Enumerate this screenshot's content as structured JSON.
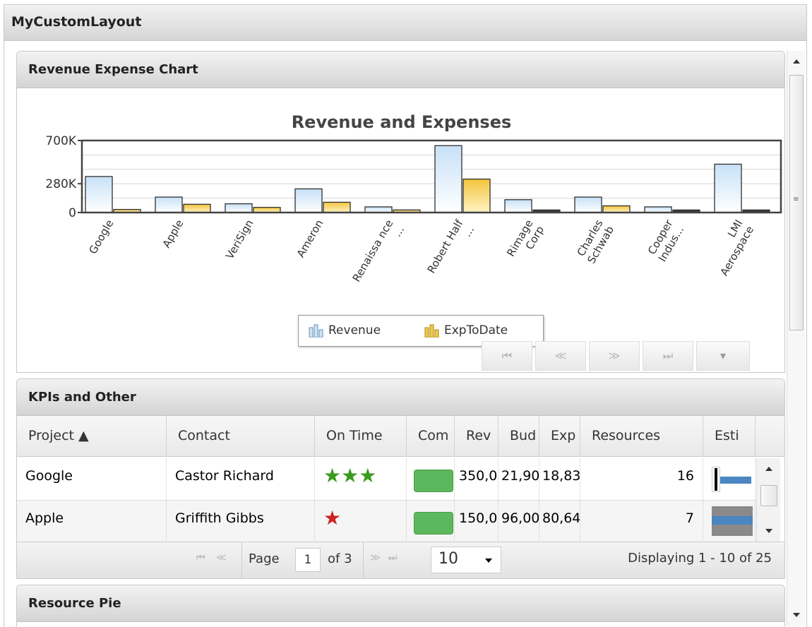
{
  "outer": {
    "title": "MyCustomLayout"
  },
  "panels": {
    "chart": {
      "title": "Revenue Expense Chart"
    },
    "kpi": {
      "title": "KPIs and Other"
    },
    "pie": {
      "title": "Resource Pie"
    }
  },
  "chart_data": {
    "type": "bar",
    "title": "Revenue and Expenses",
    "categories": [
      "Google",
      "Apple",
      "VeriSign",
      "Ameron",
      "Renaissa nce ...",
      "Robert Half ...",
      "Rimage Corp",
      "Charles Schwab",
      "Cooper Indus...",
      "LMI Aerospace"
    ],
    "series": [
      {
        "name": "Revenue",
        "values": [
          350000,
          150000,
          85000,
          230000,
          55000,
          650000,
          125000,
          150000,
          55000,
          470000
        ]
      },
      {
        "name": "ExpToDate",
        "values": [
          30000,
          80000,
          50000,
          100000,
          25000,
          325000,
          25000,
          65000,
          25000,
          25000
        ]
      }
    ],
    "yticks": [
      "700K",
      "280K",
      "0"
    ],
    "ylim": [
      0,
      700000
    ],
    "legend": "bottom-center",
    "colors": {
      "Revenue": "#cde4f7",
      "ExpToDate": "#f2c94c"
    },
    "pager": [
      "⏮",
      "≪",
      "≫",
      "⏭",
      "▾"
    ]
  },
  "grid": {
    "columns": [
      "Project ▲",
      "Contact",
      "On Time",
      "Com",
      "Rev",
      "Bud",
      "Exp",
      "Resources",
      "Esti"
    ],
    "rows": [
      {
        "project": "Google",
        "contact": "Castor Richard",
        "stars": "★★★",
        "complete": 1.0,
        "rev": "350,0",
        "bud": "21,90",
        "exp": "18,83",
        "resources": "16",
        "estimate": 0.1
      },
      {
        "project": "Apple",
        "contact": "Griffith Gibbs",
        "stars": "★",
        "complete": 1.0,
        "rev": "150,0",
        "bud": "96,00",
        "exp": "80,64",
        "resources": "7",
        "estimate": 0.0
      }
    ],
    "star_colors": [
      "#3c9a1e",
      "#cc2222"
    ],
    "footer": {
      "first": "⏮",
      "prev": "≪",
      "page_label": "Page",
      "page_value": "1",
      "of": "of 3",
      "next": "≫",
      "last": "⏭",
      "page_size": "10",
      "display": "Displaying 1 - 10 of 25"
    }
  }
}
